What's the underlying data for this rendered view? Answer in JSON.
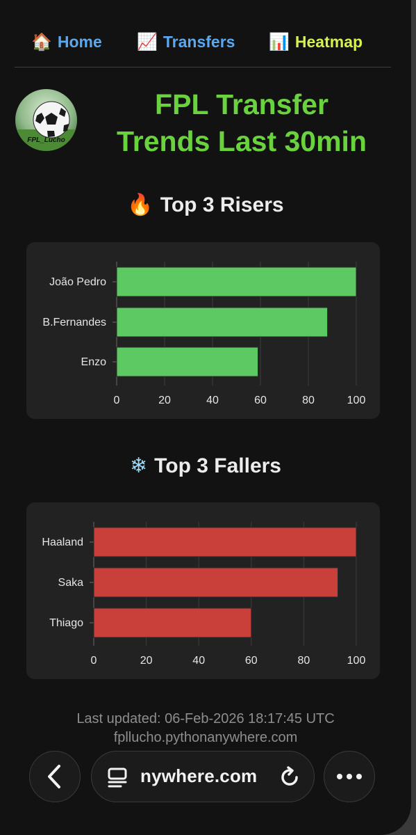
{
  "nav": {
    "home": {
      "icon": "🏠",
      "label": "Home"
    },
    "transfers": {
      "icon": "📈",
      "label": "Transfers"
    },
    "heatmap": {
      "icon": "📊",
      "label": "Heatmap"
    }
  },
  "logo": {
    "text": "FPL_Lucho"
  },
  "header": {
    "title_line1": "FPL Transfer",
    "title_line2": "Trends Last 30min"
  },
  "risers": {
    "icon": "🔥",
    "title": "Top 3 Risers"
  },
  "fallers": {
    "icon": "❄",
    "title": "Top 3 Fallers"
  },
  "chart_data": [
    {
      "type": "bar",
      "orientation": "horizontal",
      "categories": [
        "João Pedro",
        "B.Fernandes",
        "Enzo"
      ],
      "values": [
        100,
        88,
        59
      ],
      "xlim": [
        0,
        100
      ],
      "xticks": [
        0,
        20,
        40,
        60,
        80,
        100
      ],
      "color": "#5cc963",
      "grid": true
    },
    {
      "type": "bar",
      "orientation": "horizontal",
      "categories": [
        "Haaland",
        "Saka",
        "Thiago"
      ],
      "values": [
        100,
        93,
        60
      ],
      "xlim": [
        0,
        100
      ],
      "xticks": [
        0,
        20,
        40,
        60,
        80,
        100
      ],
      "color": "#c9403a",
      "grid": true
    }
  ],
  "footer": {
    "updated": "Last updated: 06-Feb-2026 18:17:45 UTC",
    "site": "fpllucho.pythonanywhere.com"
  },
  "browser": {
    "url": "nywhere.com"
  }
}
